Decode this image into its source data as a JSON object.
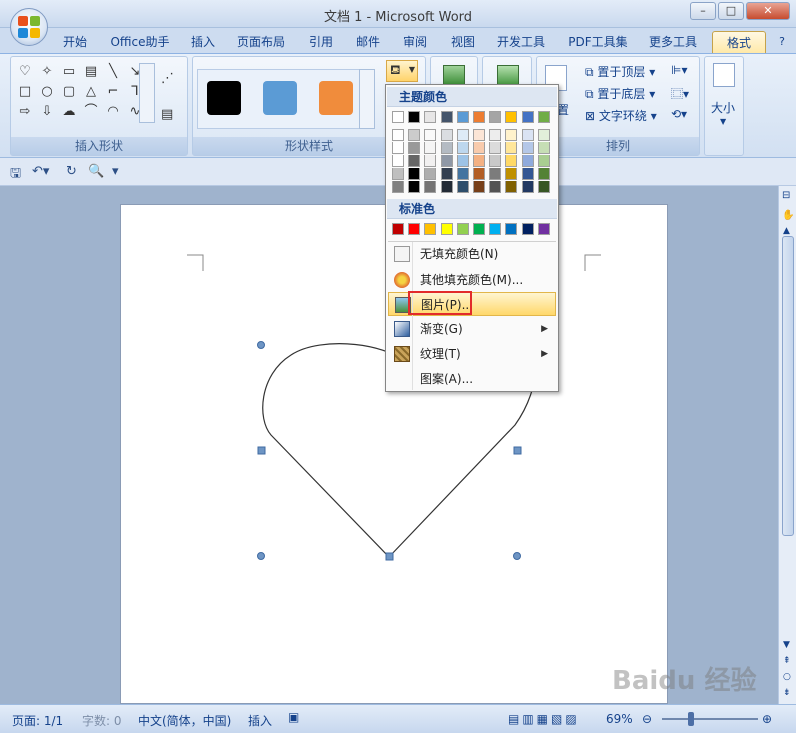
{
  "window": {
    "title": "文档 1 - Microsoft Word",
    "min": "–",
    "max": "□",
    "close": "✕"
  },
  "tabs": [
    "开始",
    "Office助手",
    "插入",
    "页面布局",
    "引用",
    "邮件",
    "审阅",
    "视图",
    "开发工具",
    "PDF工具集",
    "更多工具",
    "格式"
  ],
  "ribbon": {
    "groups": {
      "insert_shapes": "插入形状",
      "shape_styles": "形状样式",
      "arrange": "排列"
    },
    "arrange_items": {
      "bring_front": "置于顶层",
      "send_back": "置于底层",
      "text_wrap": "文字环绕",
      "position": "置"
    },
    "size_label": "大小",
    "style_colors": [
      "#000000",
      "#5b9bd5",
      "#f08c3c"
    ]
  },
  "fill_menu": {
    "theme_header": "主题颜色",
    "standard_header": "标准色",
    "theme_top": [
      "#ffffff",
      "#000000",
      "#e7e6e6",
      "#44546a",
      "#5b9bd5",
      "#ed7d31",
      "#a5a5a5",
      "#ffc000",
      "#4472c4",
      "#70ad47"
    ],
    "standard": [
      "#c00000",
      "#ff0000",
      "#ffc000",
      "#ffff00",
      "#92d050",
      "#00b050",
      "#00b0f0",
      "#0070c0",
      "#002060",
      "#7030a0"
    ],
    "items": {
      "no_fill": "无填充颜色(N)",
      "more_colors": "其他填充颜色(M)...",
      "picture": "图片(P)...",
      "gradient": "渐变(G)",
      "texture": "纹理(T)",
      "pattern": "图案(A)..."
    }
  },
  "status": {
    "page": "页面: 1/1",
    "words": "字数: 0",
    "lang": "中文(简体，中国)",
    "mode": "插入",
    "zoom": "69%"
  },
  "watermark": "Baidu 经验"
}
